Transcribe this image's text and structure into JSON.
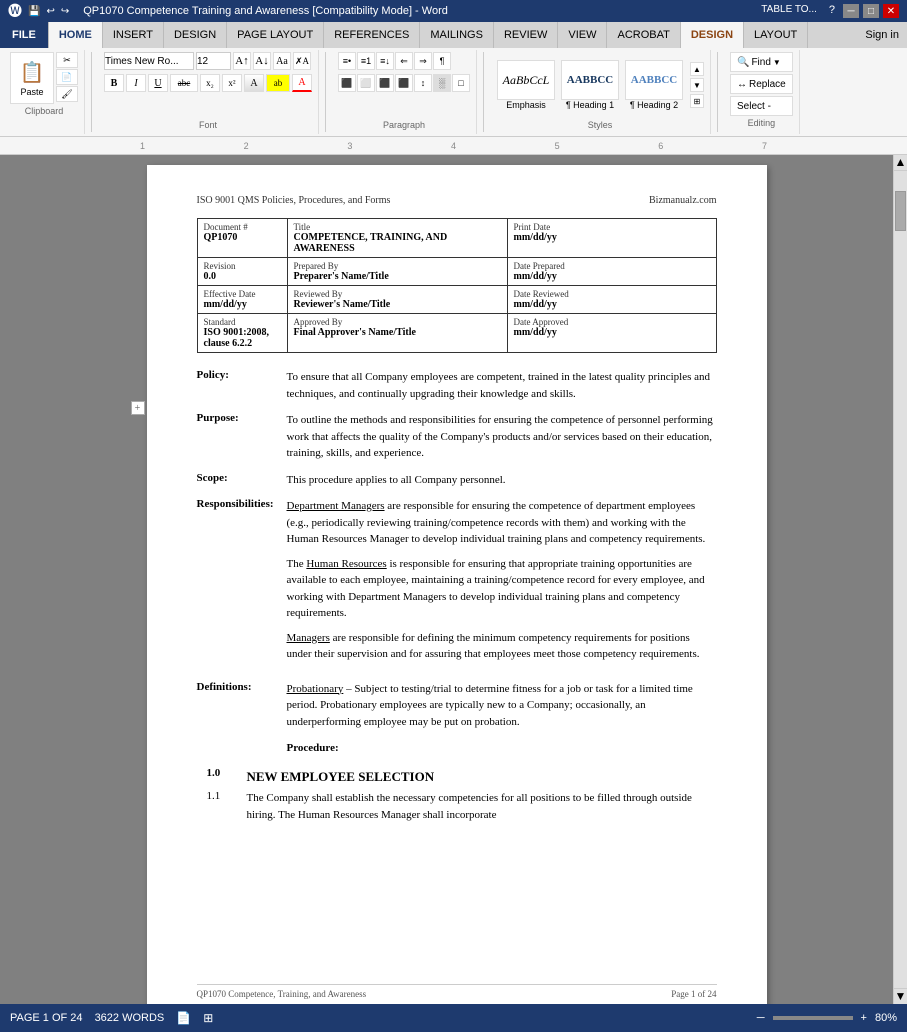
{
  "titleBar": {
    "title": "QP1070 Competence Training and Awareness [Compatibility Mode] - Word",
    "tableTools": "TABLE TO...",
    "help": "?",
    "signIn": "Sign in"
  },
  "tabs": {
    "file": "FILE",
    "home": "HOME",
    "insert": "INSERT",
    "design": "DESIGN",
    "pageLayout": "PAGE LAYOUT",
    "references": "REFERENCES",
    "mailings": "MAILINGS",
    "review": "REVIEW",
    "view": "VIEW",
    "acrobat": "ACROBAT",
    "tableDesign": "DESIGN",
    "tableLayout": "LAYOUT"
  },
  "ribbon": {
    "clipboard": {
      "label": "Clipboard",
      "paste": "Paste",
      "cut": "Cut",
      "copy": "Copy",
      "formatPainter": "Format Painter"
    },
    "font": {
      "label": "Font",
      "fontName": "Times New Ro...",
      "fontSize": "12",
      "bold": "B",
      "italic": "I",
      "underline": "U",
      "strikethrough": "abc",
      "subscript": "x₂",
      "superscript": "x²",
      "clearFormatting": "A",
      "fontColor": "A",
      "highlight": "ab"
    },
    "paragraph": {
      "label": "Paragraph",
      "bullets": "≡",
      "numbering": "≡",
      "multilevel": "≡",
      "decreaseIndent": "←",
      "increaseIndent": "→",
      "showMarks": "¶",
      "alignLeft": "≡",
      "alignCenter": "≡",
      "alignRight": "≡",
      "justify": "≡",
      "lineSpacing": "↕",
      "shading": "░",
      "border": "□"
    },
    "styles": {
      "label": "Styles",
      "emphasis": {
        "preview": "AaBbCcL",
        "label": "Emphasis",
        "style": "italic"
      },
      "heading1": {
        "preview": "AABBCC",
        "label": "¶ Heading 1"
      },
      "heading2": {
        "preview": "AABBCC",
        "label": "¶ Heading 2"
      }
    },
    "editing": {
      "label": "Editing",
      "find": "Find",
      "replace": "Replace",
      "select": "Select -"
    }
  },
  "document": {
    "header": {
      "left": "ISO 9001 QMS Policies, Procedures, and Forms",
      "right": "Bizmanualz.com"
    },
    "table": {
      "rows": [
        {
          "col1Label": "Document #",
          "col1Value": "QP1070",
          "col2Label": "Title",
          "col2Value": "COMPETENCE, TRAINING, AND AWARENESS",
          "col3Label": "Print Date",
          "col3Value": "mm/dd/yy"
        },
        {
          "col1Label": "Revision",
          "col1Value": "0.0",
          "col2Label": "Prepared By",
          "col2Value": "Preparer's Name/Title",
          "col3Label": "Date Prepared",
          "col3Value": "mm/dd/yy"
        },
        {
          "col1Label": "Effective Date",
          "col1Value": "mm/dd/yy",
          "col2Label": "Reviewed By",
          "col2Value": "Reviewer's Name/Title",
          "col3Label": "Date Reviewed",
          "col3Value": "mm/dd/yy"
        },
        {
          "col1Label": "Standard",
          "col1Value": "ISO 9001:2008, clause 6.2.2",
          "col2Label": "Approved By",
          "col2Value": "Final Approver's Name/Title",
          "col3Label": "Date Approved",
          "col3Value": "mm/dd/yy"
        }
      ]
    },
    "sections": {
      "policy": {
        "label": "Policy:",
        "text": "To ensure that all Company employees are competent, trained in the latest quality principles and techniques, and continually upgrading their knowledge and skills."
      },
      "purpose": {
        "label": "Purpose:",
        "text": "To outline the methods and responsibilities for ensuring the competence of personnel performing work that affects the quality of the Company's products and/or services based on their education, training, skills, and experience."
      },
      "scope": {
        "label": "Scope:",
        "text": "This procedure applies to all Company personnel."
      },
      "responsibilities": {
        "label": "Responsibilities:",
        "para1_link": "Department Managers",
        "para1": " are responsible for ensuring the competence of department employees (e.g., periodically reviewing training/competence records with them) and working with the Human Resources Manager to develop individual training plans and competency requirements.",
        "para2_link": "Human Resources",
        "para2_pre": "The ",
        "para2": " is responsible for ensuring that appropriate training opportunities are available to each employee, maintaining a training/competence record for every employee, and working with Department Managers to develop individual training plans and competency requirements.",
        "para3_link": "Managers",
        "para3": " are responsible for defining the minimum competency requirements for positions under their supervision and for assuring that employees meet those competency requirements."
      },
      "definitions": {
        "label": "Definitions:",
        "term": "Probationary",
        "text": " – Subject to testing/trial to determine fitness for a job or task for a limited time period.  Probationary employees are typically new to a Company; occasionally, an underperforming employee may be put on probation."
      },
      "procedure": {
        "label": "Procedure:"
      },
      "section1": {
        "num": "1.0",
        "title": "NEW EMPLOYEE SELECTION"
      },
      "section1_1": {
        "num": "1.1",
        "text": "The Company shall establish the necessary competencies for all positions to be filled through outside hiring.  The Human Resources Manager shall incorporate"
      }
    },
    "footer": {
      "left": "QP1070  Competence, Training, and Awareness",
      "right": "Page 1 of 24"
    }
  },
  "statusBar": {
    "page": "PAGE 1 OF 24",
    "words": "3622 WORDS",
    "zoom": "80%"
  }
}
